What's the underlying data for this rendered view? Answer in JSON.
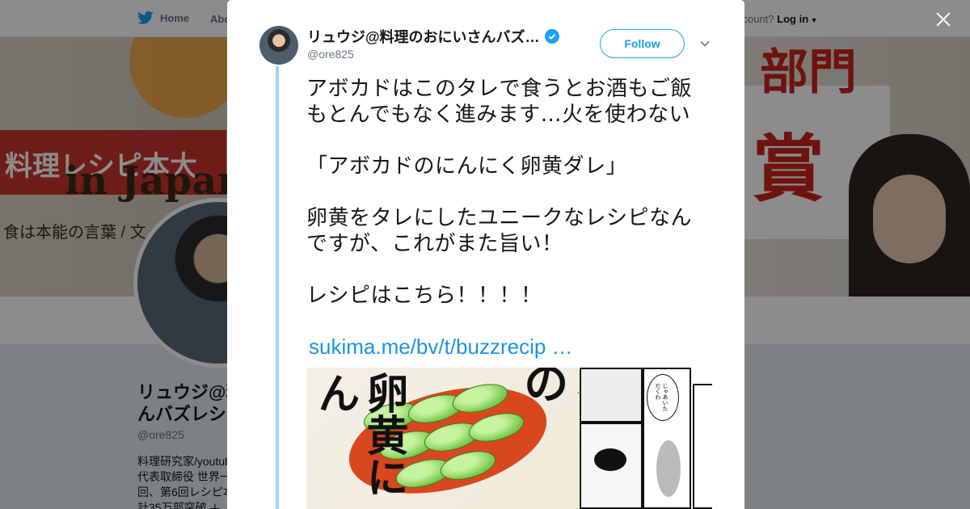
{
  "background_page": {
    "nav": {
      "home_label": "Home",
      "about_label": "Abo",
      "account_prompt": "ccount?",
      "login_label": "Log in"
    },
    "banner": {
      "title": "料理レシピ本大",
      "subtitle": "in Japan",
      "caption": "食は本能の言葉 / 文",
      "right_kanji_top": "部門",
      "right_kanji": "賞"
    },
    "profile": {
      "name_line1": "リュウジ@料理のおにいさんバズレシピ",
      "name_line2": "んバズレシ",
      "handle": "@ore825",
      "bio_lines": [
        "料理研究家/youtube",
        "代表取締役 世界一",
        "回、第6回レシピ本",
        "計35万部突破 ㅗ"
      ]
    }
  },
  "modal": {
    "author": {
      "name": "リュウジ@料理のおにいさんバズ…",
      "handle": "@ore825",
      "verified": true
    },
    "follow_label": "Follow",
    "tweet": {
      "text": "アボカドはこのタレで食うとお酒もご飯もとんでもなく進みます…火を使わない\n\n「アボカドのにんにく卵黄ダレ」\n\n卵黄をタレにしたユニークなレシピなんですが、これがまた旨い！\n\nレシピはこちら！！！！",
      "link": "sukima.me/bv/t/buzzrecip …"
    },
    "media": [
      {
        "type": "cover",
        "text_left": "卵黄にん",
        "text_right": "ボカドの"
      },
      {
        "type": "manga",
        "bubble_text": "じゃあいただくわ"
      }
    ]
  },
  "colors": {
    "accent": "#1da1f2",
    "link": "#1b95e0",
    "thread_line": "#9fd4f5",
    "overlay": "rgba(0,0,0,0.45)"
  },
  "icons": [
    "twitter-bird-icon",
    "caret-down-icon",
    "verified-badge-icon",
    "close-icon",
    "chevron-down-icon"
  ]
}
